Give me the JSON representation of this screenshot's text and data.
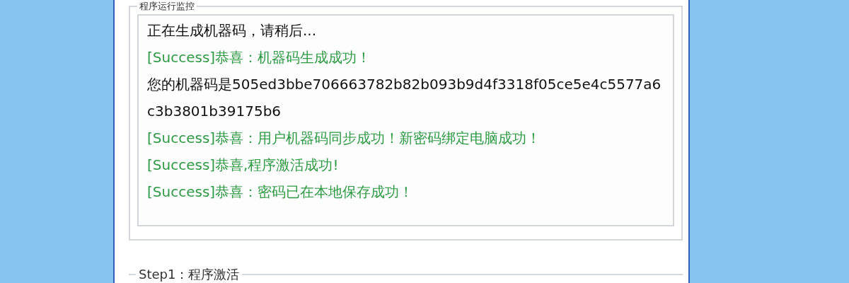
{
  "monitor": {
    "title": "程序运行监控",
    "log": [
      {
        "kind": "info",
        "text": "正在生成机器码，请稍后..."
      },
      {
        "kind": "success",
        "text": "[Success]恭喜：机器码生成成功！"
      },
      {
        "kind": "info",
        "text": "您的机器码是505ed3bbe706663782b82b093b9d4f3318f05ce5e4c5577a6c3b3801b39175b6"
      },
      {
        "kind": "success",
        "text": "[Success]恭喜：用户机器码同步成功！新密码绑定电脑成功！"
      },
      {
        "kind": "success",
        "text": "[Success]恭喜,程序激活成功!"
      },
      {
        "kind": "success",
        "text": "[Success]恭喜：密码已在本地保存成功！"
      }
    ]
  },
  "step1": {
    "title": "Step1：程序激活"
  }
}
